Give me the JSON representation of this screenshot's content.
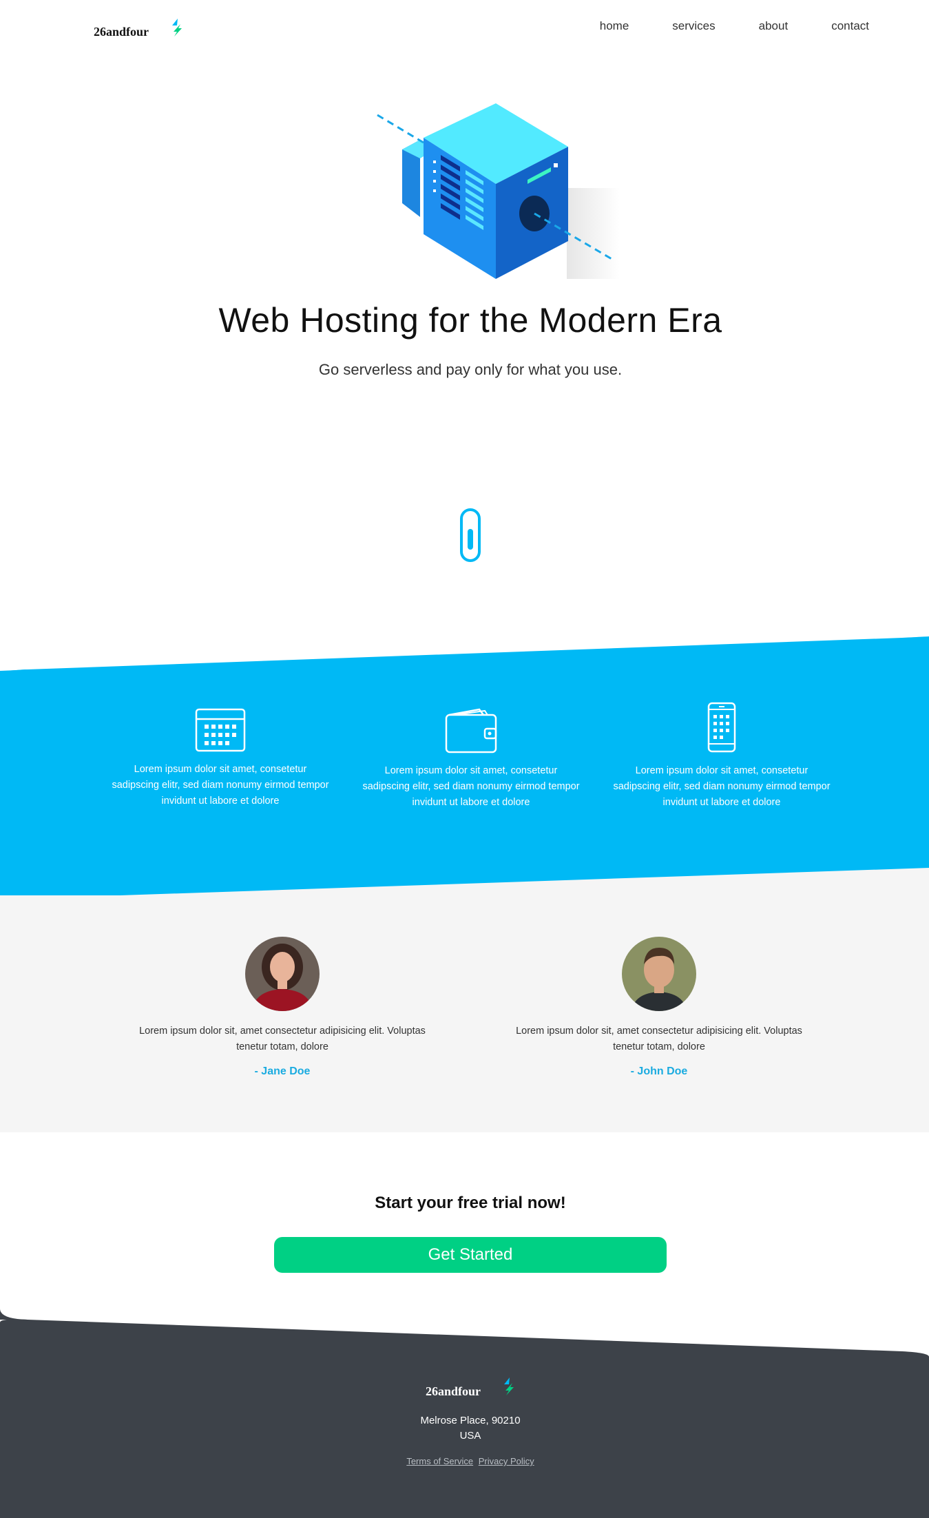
{
  "brand": {
    "name": "26andfour"
  },
  "nav": {
    "items": [
      "home",
      "services",
      "about",
      "contact"
    ]
  },
  "hero": {
    "title": "Web Hosting for the Modern Era",
    "subtitle": "Go serverless and pay only for what you use."
  },
  "features": [
    {
      "icon": "calendar-icon",
      "text": "Lorem ipsum dolor sit amet, consetetur sadipscing elitr, sed diam nonumy eirmod tempor invidunt ut labore et dolore"
    },
    {
      "icon": "wallet-icon",
      "text": "Lorem ipsum dolor sit amet, consetetur sadipscing elitr, sed diam nonumy eirmod tempor invidunt ut labore et dolore"
    },
    {
      "icon": "phone-icon",
      "text": "Lorem ipsum dolor sit amet, consetetur sadipscing elitr, sed diam nonumy eirmod tempor invidunt ut labore et dolore"
    }
  ],
  "testimonials": [
    {
      "quote": "Lorem ipsum dolor sit, amet consectetur adipisicing elit. Voluptas tenetur totam, dolore",
      "name": "- Jane Doe"
    },
    {
      "quote": "Lorem ipsum dolor sit, amet consectetur adipisicing elit. Voluptas tenetur totam, dolore",
      "name": "- John Doe"
    }
  ],
  "cta": {
    "title": "Start your free trial now!",
    "button": "Get Started"
  },
  "footer": {
    "brand": "26andfour",
    "address_line1": "Melrose Place, 90210",
    "address_line2": "USA",
    "terms": "Terms of Service",
    "privacy": "Privacy Policy"
  },
  "colors": {
    "accent": "#00b9f5",
    "cta": "#00d084",
    "footer": "#3d4249",
    "grey": "#f5f5f5"
  }
}
